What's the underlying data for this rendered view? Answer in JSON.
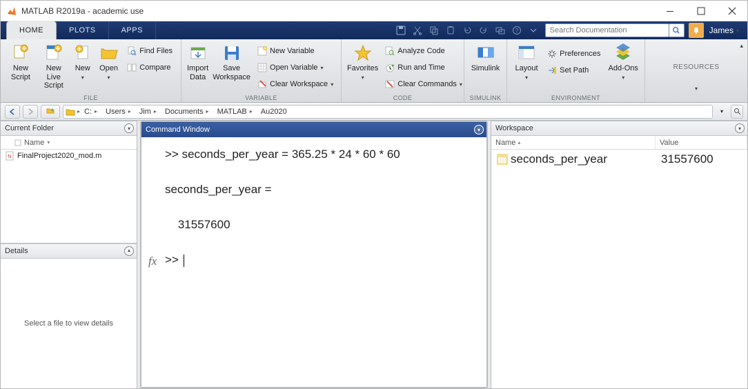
{
  "title": "MATLAB R2019a - academic use",
  "tabs": {
    "home": "HOME",
    "plots": "PLOTS",
    "apps": "APPS"
  },
  "search": {
    "placeholder": "Search Documentation"
  },
  "user": "James",
  "ribbon": {
    "file": {
      "label": "FILE",
      "new_script": "New\nScript",
      "new_live_script": "New\nLive Script",
      "new": "New",
      "open": "Open",
      "find_files": "Find Files",
      "compare": "Compare"
    },
    "variable": {
      "label": "VARIABLE",
      "import_data": "Import\nData",
      "save_workspace": "Save\nWorkspace",
      "new_variable": "New Variable",
      "open_variable": "Open Variable",
      "clear_workspace": "Clear Workspace"
    },
    "code": {
      "label": "CODE",
      "favorites": "Favorites",
      "analyze": "Analyze Code",
      "run_time": "Run and Time",
      "clear_cmds": "Clear Commands"
    },
    "simulink": {
      "label": "SIMULINK",
      "btn": "Simulink"
    },
    "environment": {
      "label": "ENVIRONMENT",
      "layout": "Layout",
      "preferences": "Preferences",
      "set_path": "Set Path",
      "addons": "Add-Ons"
    },
    "resources": {
      "label": "RESOURCES"
    }
  },
  "breadcrumb": [
    "C:",
    "Users",
    "Jim",
    "Documents",
    "MATLAB",
    "Au2020"
  ],
  "panels": {
    "current_folder": "Current Folder",
    "command_window": "Command Window",
    "workspace": "Workspace",
    "details": "Details"
  },
  "current_folder": {
    "col_name": "Name",
    "files": [
      "FinalProject2020_mod.m"
    ]
  },
  "details_placeholder": "Select a file to view details",
  "command": {
    "input1": ">> seconds_per_year = 365.25 * 24 * 60 * 60",
    "echo": "seconds_per_year =",
    "result": "    31557600",
    "prompt2": ">> "
  },
  "workspace": {
    "col_name": "Name",
    "col_value": "Value",
    "vars": [
      {
        "name": "seconds_per_year",
        "value": "31557600"
      }
    ]
  }
}
